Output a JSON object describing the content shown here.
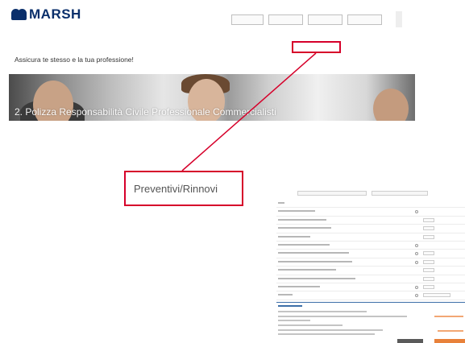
{
  "header": {
    "logo_text": "MARSH",
    "brand_color": "#0a2f6b",
    "top_buttons": [
      "",
      "",
      "",
      ""
    ]
  },
  "nav": {
    "items": [
      {
        "label": ""
      },
      {
        "label": ""
      },
      {
        "label": ""
      },
      {
        "label": ""
      },
      {
        "label": ""
      },
      {
        "label": ""
      }
    ],
    "highlighted_index": 2,
    "highlight_color": "#d6002a"
  },
  "tagline": "Assicura te stesso e la tua professione!",
  "hero": {
    "caption": "2. Polizza Responsabilità Civile Professionale Commercialisti"
  },
  "callout": {
    "label": "Preventivi/Rinnovi",
    "color": "#d6002a"
  },
  "form": {
    "tabs": [
      "",
      ""
    ],
    "row_count": 12
  }
}
